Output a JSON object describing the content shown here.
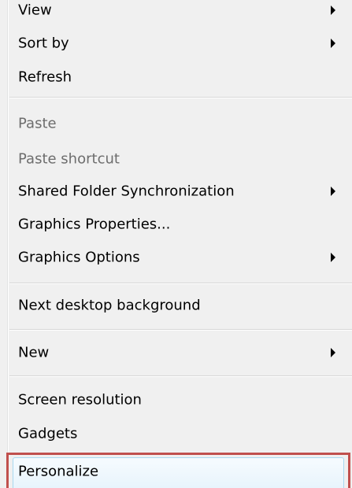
{
  "menu": {
    "items": [
      {
        "label": "View",
        "submenu": true,
        "disabled": false
      },
      {
        "label": "Sort by",
        "submenu": true,
        "disabled": false
      },
      {
        "label": "Refresh",
        "submenu": false,
        "disabled": false
      },
      {
        "label": "Paste",
        "submenu": false,
        "disabled": true
      },
      {
        "label": "Paste shortcut",
        "submenu": false,
        "disabled": true
      },
      {
        "label": "Shared Folder Synchronization",
        "submenu": true,
        "disabled": false
      },
      {
        "label": "Graphics Properties...",
        "submenu": false,
        "disabled": false
      },
      {
        "label": "Graphics Options",
        "submenu": true,
        "disabled": false
      },
      {
        "label": "Next desktop background",
        "submenu": false,
        "disabled": false
      },
      {
        "label": "New",
        "submenu": true,
        "disabled": false
      },
      {
        "label": "Screen resolution",
        "submenu": false,
        "disabled": false
      },
      {
        "label": "Gadgets",
        "submenu": false,
        "disabled": false
      },
      {
        "label": "Personalize",
        "submenu": false,
        "disabled": false,
        "hovered": true
      }
    ]
  },
  "colors": {
    "menu_background": "#f0f0f0",
    "disabled_text": "#6d6d6d",
    "highlight_border": "#c0504d",
    "hover_border": "#a8d8f0"
  },
  "icons": {
    "submenu": "chevron-right-icon"
  }
}
